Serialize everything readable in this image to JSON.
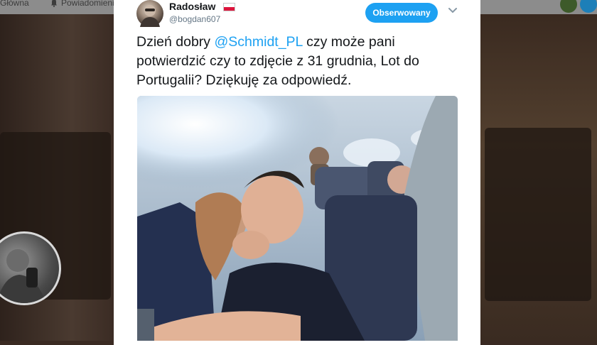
{
  "nav": {
    "home_label": "Główna",
    "notifications_label": "Powiadomienia"
  },
  "tweet": {
    "author_name": "Radosław",
    "author_handle": "@bogdan607",
    "follow_label": "Obserwowany",
    "text_before": "Dzień dobry ",
    "mention": "@Schmidt_PL",
    "text_after": " czy może pani potwierdzić czy to zdjęcie z 31 grudnia, Lot do Portugalii? Dziękuję za odpowiedź."
  },
  "icons": {
    "home": "home-icon",
    "notifications": "bell-icon",
    "menu": "chevron-down-icon",
    "flag": "polish-flag-icon"
  },
  "colors": {
    "accent": "#1da1f2",
    "text": "#14171a",
    "muted": "#657786"
  }
}
